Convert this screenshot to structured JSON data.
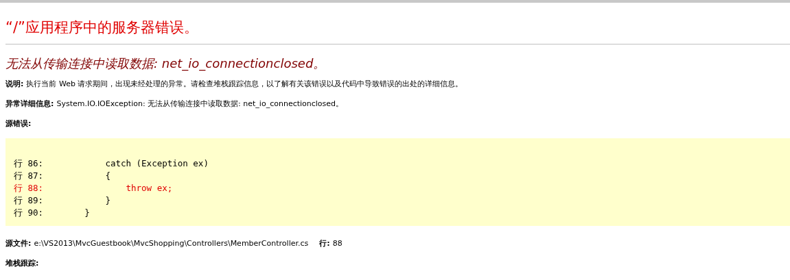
{
  "title": "“/”应用程序中的服务器错误。",
  "subtitle": "无法从传输连接中读取数据: net_io_connectionclosed。",
  "description": {
    "label": "说明:",
    "text": "执行当前 Web 请求期间，出现未经处理的异常。请检查堆栈跟踪信息，以了解有关该错误以及代码中导致错误的出处的详细信息。"
  },
  "exception_details": {
    "label": "异常详细信息:",
    "text": "System.IO.IOException: 无法从传输连接中读取数据: net_io_connectionclosed。"
  },
  "source_error": {
    "label": "源错误:",
    "lines": [
      {
        "text": "行 86:            catch (Exception ex)",
        "highlighted": false
      },
      {
        "text": "行 87:            {",
        "highlighted": false
      },
      {
        "text": "行 88:                throw ex;",
        "highlighted": true
      },
      {
        "text": "行 89:            }",
        "highlighted": false
      },
      {
        "text": "行 90:        }",
        "highlighted": false
      }
    ]
  },
  "source_file": {
    "label": "源文件:",
    "text": "e:\\VS2013\\MvcGuestbook\\MvcShopping\\Controllers\\MemberController.cs",
    "line_label": "行:",
    "line": "88"
  },
  "stack_trace": {
    "label": "堆栈跟踪:"
  }
}
